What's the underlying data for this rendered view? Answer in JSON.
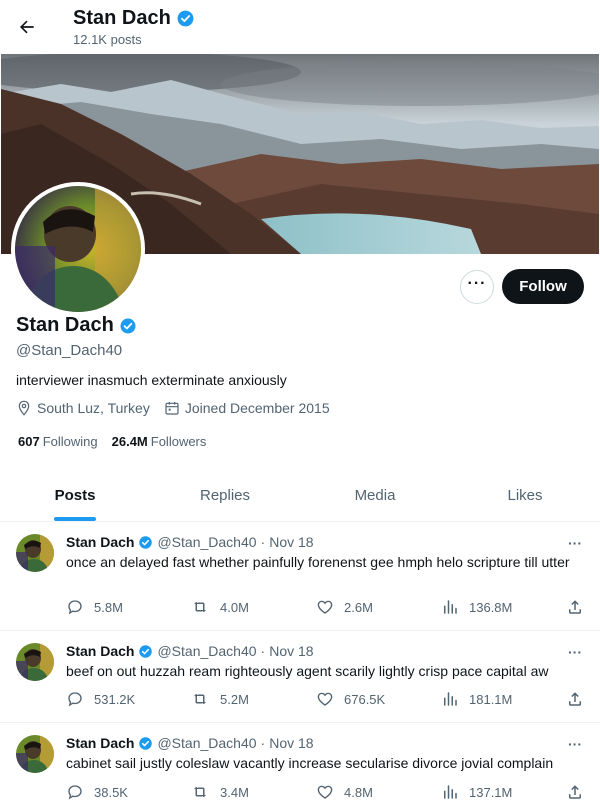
{
  "header": {
    "name": "Stan Dach",
    "posts_count": "12.1K posts"
  },
  "profile": {
    "name": "Stan Dach",
    "handle": "@Stan_Dach40",
    "bio": "interviewer inasmuch exterminate anxiously",
    "location": "South Luz, Turkey",
    "joined": "Joined December 2015",
    "following_count": "607",
    "following_label": "Following",
    "followers_count": "26.4M",
    "followers_label": "Followers",
    "follow_label": "Follow",
    "more_label": "···"
  },
  "tabs": [
    {
      "label": "Posts",
      "active": true
    },
    {
      "label": "Replies",
      "active": false
    },
    {
      "label": "Media",
      "active": false
    },
    {
      "label": "Likes",
      "active": false
    }
  ],
  "tweets": [
    {
      "name": "Stan Dach",
      "handle": "@Stan_Dach40",
      "dot": "·",
      "date": "Nov 18",
      "text": "once an delayed fast whether painfully forenenst gee hmph helo scripture till utter",
      "replies": "5.8M",
      "retweets": "4.0M",
      "likes": "2.6M",
      "views": "136.8M"
    },
    {
      "name": "Stan Dach",
      "handle": "@Stan_Dach40",
      "dot": "·",
      "date": "Nov 18",
      "text": "beef on out huzzah ream righteously agent scarily lightly crisp pace capital aw",
      "replies": "531.2K",
      "retweets": "5.2M",
      "likes": "676.5K",
      "views": "181.1M"
    },
    {
      "name": "Stan Dach",
      "handle": "@Stan_Dach40",
      "dot": "·",
      "date": "Nov 18",
      "text": "cabinet sail justly coleslaw vacantly increase secularise divorce jovial complain",
      "replies": "38.5K",
      "retweets": "3.4M",
      "likes": "4.8M",
      "views": "137.1M"
    }
  ],
  "icons": {
    "back": "arrow-left-icon",
    "verified": "verified-badge-icon",
    "location": "location-pin-icon",
    "calendar": "calendar-icon",
    "reply": "reply-icon",
    "retweet": "retweet-icon",
    "like": "heart-icon",
    "views": "views-icon",
    "share": "share-icon",
    "more": "more-icon"
  },
  "colors": {
    "accent": "#1d9bf0",
    "text": "#0f1419",
    "muted": "#536471",
    "follow_bg": "#0f1419"
  }
}
